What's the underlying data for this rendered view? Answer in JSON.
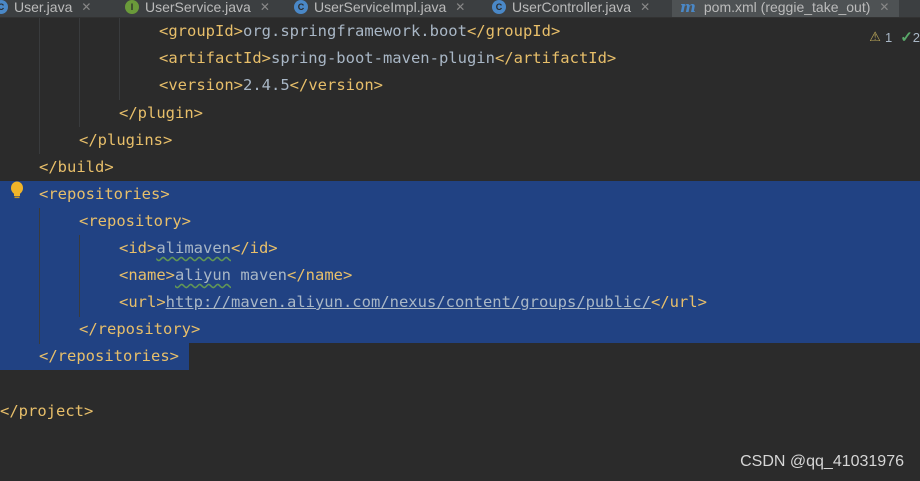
{
  "tabs": [
    {
      "label": "User.java",
      "icon": "class-icon",
      "active": false
    },
    {
      "label": "UserService.java",
      "icon": "interface-icon",
      "active": false
    },
    {
      "label": "UserServiceImpl.java",
      "icon": "class-icon",
      "active": false
    },
    {
      "label": "UserController.java",
      "icon": "class-icon",
      "active": false
    },
    {
      "label": "pom.xml (reggie_take_out)",
      "icon": "maven-icon",
      "active": true
    }
  ],
  "inspections": {
    "warnings": "1",
    "ok": "2"
  },
  "code": {
    "groupId_open": "<groupId>",
    "groupId_value": "org.springframework.boot",
    "groupId_close": "</groupId>",
    "artifactId_open": "<artifactId>",
    "artifactId_value": "spring-boot-maven-plugin",
    "artifactId_close": "</artifactId>",
    "version_open": "<version>",
    "version_value": "2.4.5",
    "version_close": "</version>",
    "plugin_close": "</plugin>",
    "plugins_close": "</plugins>",
    "build_close": "</build>",
    "repositories_open": "<repositories>",
    "repository_open": "<repository>",
    "id_open": "<id>",
    "id_value": "alimaven",
    "id_close": "</id>",
    "name_open": "<name>",
    "name_value_1": "aliyun",
    "name_value_2": " maven",
    "name_close": "</name>",
    "url_open": "<url>",
    "url_value": "http://maven.aliyun.com/nexus/content/groups/public/",
    "url_close": "</url>",
    "repository_close": "</repository>",
    "repositories_close": "</repositories>",
    "project_close": "</project>"
  },
  "watermark": "CSDN @qq_41031976",
  "colors": {
    "background": "#2b2b2b",
    "selection": "#214283",
    "tag": "#e8bf6a",
    "text": "#a9b7c6"
  }
}
